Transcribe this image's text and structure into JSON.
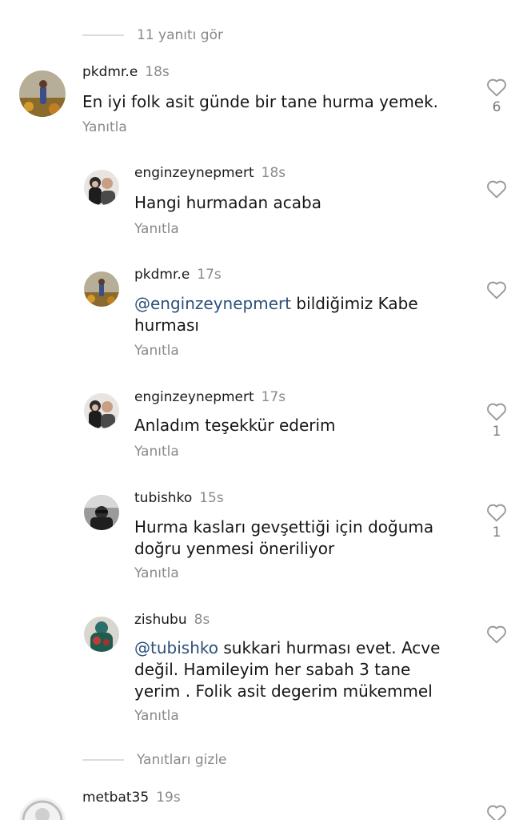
{
  "thread": {
    "view_replies_label": "11 yanıtı gör",
    "hide_replies_label": "Yanıtları gizle",
    "reply_label": "Yanıtla"
  },
  "comments": [
    {
      "username": "pkdmr.e",
      "time": "18s",
      "text": "En iyi folk asit günde bir  tane hurma yemek.",
      "mention": "",
      "likes": "6"
    },
    {
      "username": "enginzeynepmert",
      "time": "18s",
      "text": "Hangi hurmadan acaba",
      "mention": "",
      "likes": ""
    },
    {
      "username": "pkdmr.e",
      "time": "17s",
      "mention": "@enginzeynepmert",
      "text": " bildiğimiz Kabe hurması",
      "likes": ""
    },
    {
      "username": "enginzeynepmert",
      "time": "17s",
      "text": "Anladım teşekkür ederim",
      "mention": "",
      "likes": "1"
    },
    {
      "username": "tubishko",
      "time": "15s",
      "text": "Hurma kasları gevşettiği için doğuma doğru yenmesi öneriliyor",
      "mention": "",
      "likes": "1"
    },
    {
      "username": "zishubu",
      "time": "8s",
      "mention": "@tubishko",
      "text": " sukkari hurması evet. Acve değil. Hamileyim her sabah 3 tane yerim . Folik asit degerim mükemmel",
      "likes": ""
    },
    {
      "username": "metbat35",
      "time": "19s",
      "text": "",
      "mention": "",
      "likes": ""
    }
  ],
  "colors": {
    "mention": "#2b4f7a",
    "muted": "#8a8a8a",
    "heart_outline": "#9a9a9a"
  },
  "icons": {
    "like": "heart-outline-icon"
  }
}
